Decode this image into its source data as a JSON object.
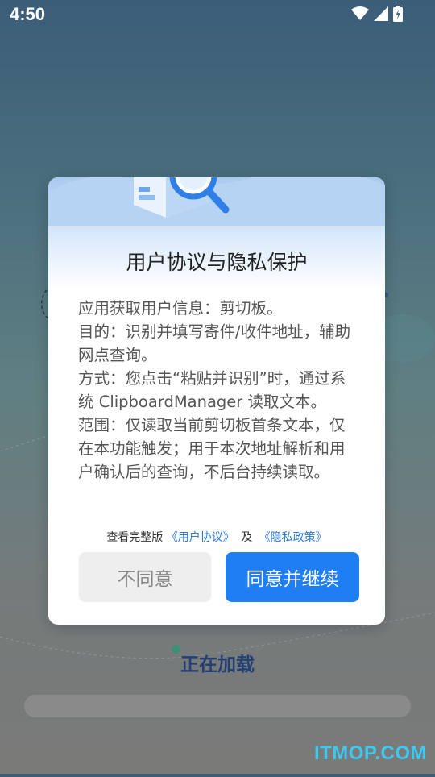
{
  "status_bar": {
    "time": "4:50",
    "icons": [
      "wifi-icon",
      "signal-icon",
      "battery-charging-icon"
    ]
  },
  "dialog": {
    "title": "用户协议与隐私保护",
    "body_lines": [
      "应用获取用户信息：剪切板。",
      "目的：识别并填写寄件/收件地址，辅助网点查询。",
      "方式：您点击“粘贴并识别”时，通过系统 ClipboardManager 读取文本。",
      "范围：仅读取当前剪切板首条文本，仅在本功能触发；用于本次地址解析和用户确认后的查询，不后台持续读取。"
    ],
    "links_prefix": "查看完整版",
    "user_agreement_link": "《用户协议》",
    "links_and": "及",
    "privacy_policy_link": "《隐私政策》",
    "disagree_label": "不同意",
    "agree_label": "同意并继续"
  },
  "loading": {
    "text": "正在加载"
  },
  "watermark": "ITMOP.COM",
  "colors": {
    "primary": "#1f7ef4",
    "link": "#2b7bdc",
    "loading_text": "#233f73",
    "watermark": "#3ec8ee"
  }
}
